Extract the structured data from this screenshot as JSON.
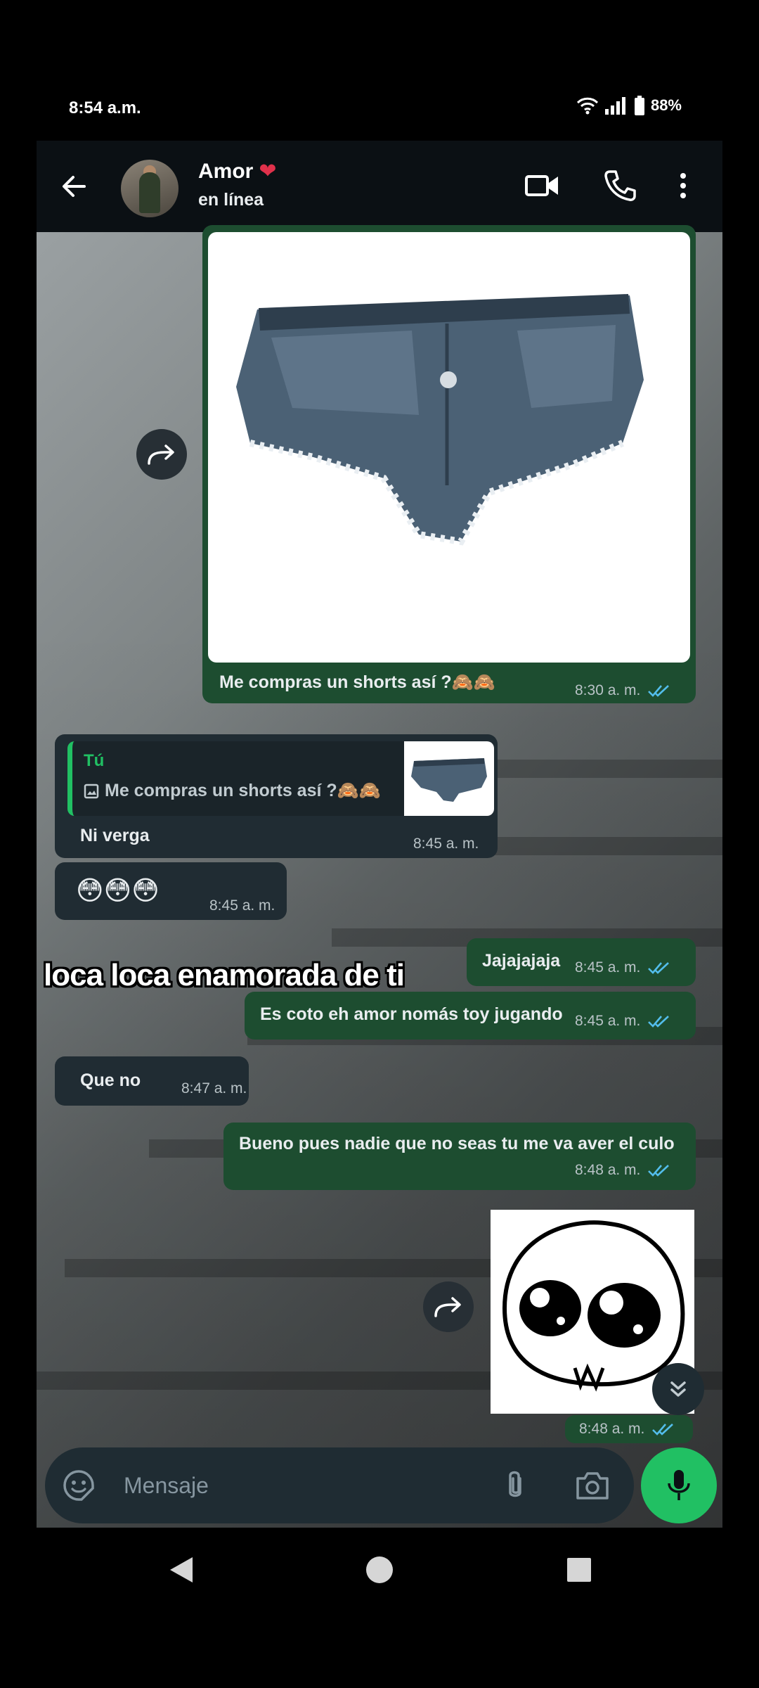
{
  "status_bar": {
    "time": "8:54 a.m.",
    "battery": "88%"
  },
  "header": {
    "name": "Amor",
    "name_emoji": "❤",
    "status": "en línea"
  },
  "messages": [
    {
      "direction": "out",
      "type": "image",
      "caption": "Me compras un shorts así ?🙈🙈",
      "time": "8:30 a. m.",
      "read": true
    },
    {
      "direction": "in",
      "type": "reply",
      "quote_author": "Tú",
      "quote_text": "Me compras un shorts así ?🙈🙈",
      "text": "Ni verga",
      "time": "8:45 a. m."
    },
    {
      "direction": "in",
      "type": "text",
      "text": "😳😳😳",
      "time": "8:45 a. m."
    },
    {
      "direction": "out",
      "type": "text",
      "text": "Jajajajaja",
      "time": "8:45 a. m.",
      "read": true
    },
    {
      "direction": "out",
      "type": "text",
      "text": "Es coto eh amor nomás toy jugando",
      "time": "8:45 a. m.",
      "read": true
    },
    {
      "direction": "in",
      "type": "text",
      "text": "Que no",
      "time": "8:47 a. m."
    },
    {
      "direction": "out",
      "type": "text",
      "text": "Bueno pues nadie que no seas tu me va aver el culo",
      "time": "8:48 a. m.",
      "read": true
    },
    {
      "direction": "out",
      "type": "sticker",
      "time": "8:48 a. m.",
      "read": true
    }
  ],
  "overlay_caption": "loca loca enamorada de ti",
  "composer": {
    "placeholder": "Mensaje"
  },
  "colors": {
    "outgoing": "#1d4d30",
    "incoming": "#202c33",
    "accent": "#21c063",
    "read_ticks": "#53bdeb"
  }
}
